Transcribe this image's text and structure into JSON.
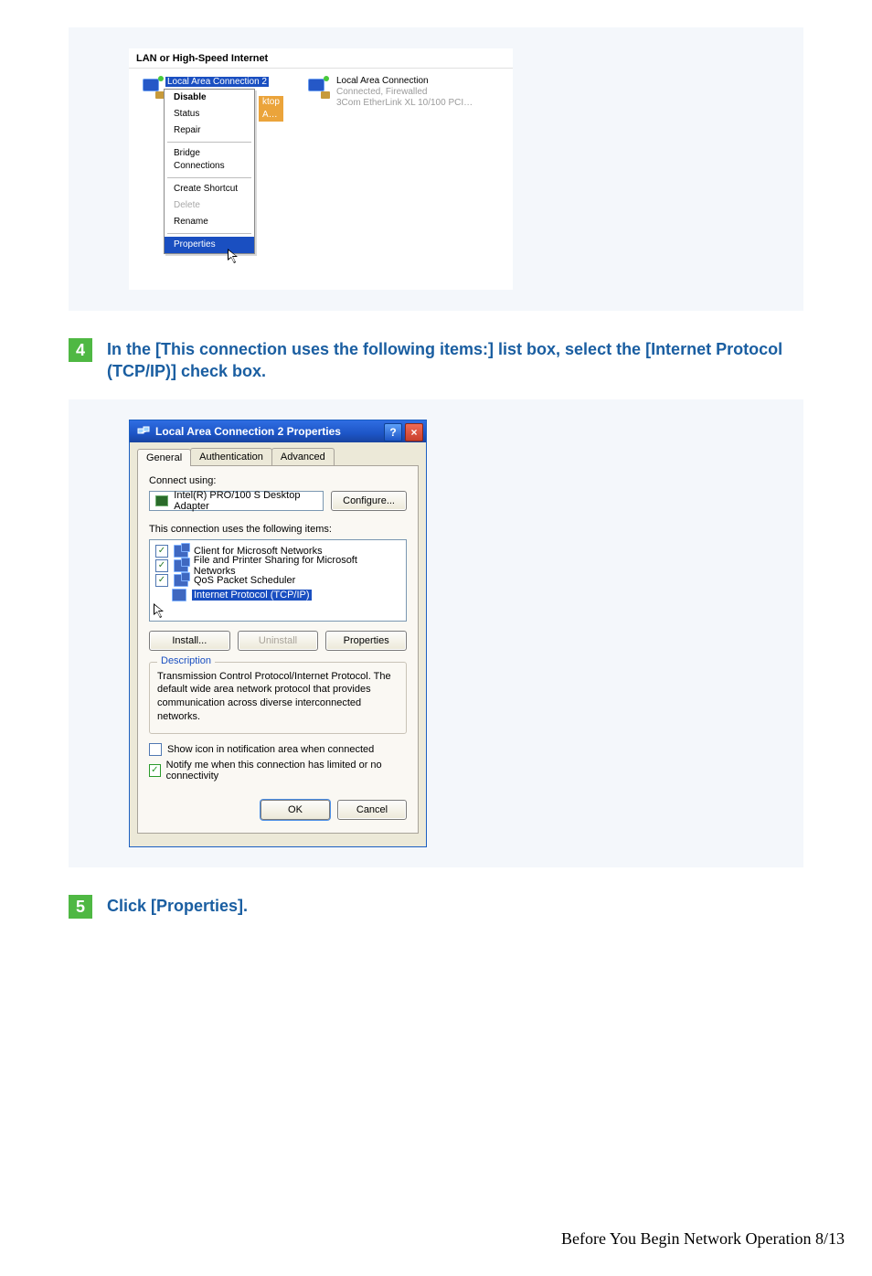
{
  "panel1": {
    "heading": "LAN or High-Speed Internet",
    "selected_conn_label": "Local Area Connection 2",
    "truncated_tag": "ktop A…",
    "ctx_menu": {
      "disable": "Disable",
      "status": "Status",
      "repair": "Repair",
      "bridge": "Bridge Connections",
      "shortcut": "Create Shortcut",
      "delete": "Delete",
      "rename": "Rename",
      "properties": "Properties"
    },
    "conn2": {
      "name": "Local Area Connection",
      "status": "Connected, Firewalled",
      "device": "3Com EtherLink XL 10/100 PCI…"
    }
  },
  "step4": {
    "num": "4",
    "text": "In the [This connection uses the following items:] list box, select the [Internet Protocol (TCP/IP)] check box."
  },
  "dialog": {
    "title": "Local Area Connection 2 Properties",
    "help": "?",
    "close": "×",
    "tabs": {
      "general": "General",
      "auth": "Authentication",
      "adv": "Advanced"
    },
    "connect_using_label": "Connect using:",
    "adapter": "Intel(R) PRO/100 S Desktop Adapter",
    "configure": "Configure...",
    "items_label": "This connection uses the following items:",
    "items": {
      "client": "Client for Microsoft Networks",
      "fps": "File and Printer Sharing for Microsoft Networks",
      "qos": "QoS Packet Scheduler",
      "tcpip": "Internet Protocol (TCP/IP)"
    },
    "install": "Install...",
    "uninstall": "Uninstall",
    "properties": "Properties",
    "desc_heading": "Description",
    "desc_body": "Transmission Control Protocol/Internet Protocol. The default wide area network protocol that provides communication across diverse interconnected networks.",
    "show_icon": "Show icon in notification area when connected",
    "notify": "Notify me when this connection has limited or no connectivity",
    "ok": "OK",
    "cancel": "Cancel"
  },
  "step5": {
    "num": "5",
    "text": "Click [Properties]."
  },
  "footer": "Before You Begin Network Operation 8/13"
}
